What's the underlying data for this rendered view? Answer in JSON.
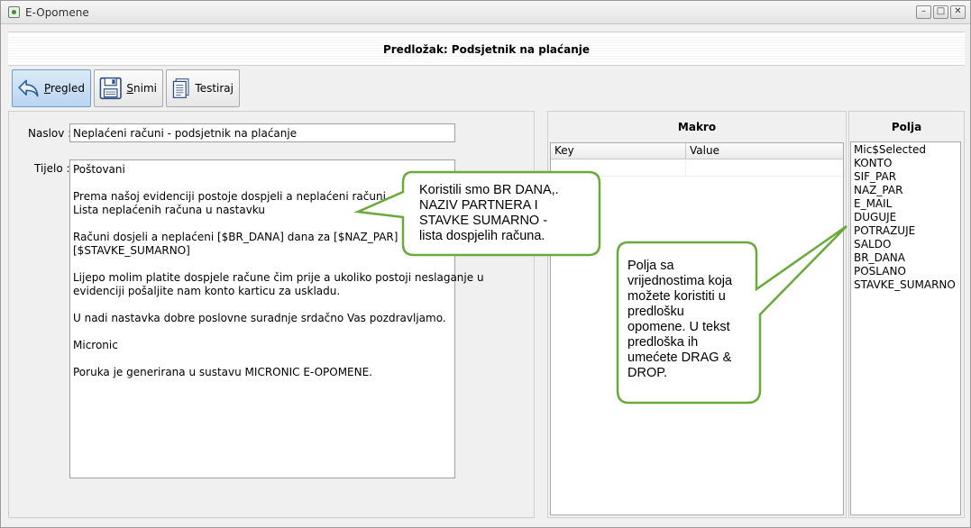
{
  "window": {
    "title": "E-Opomene",
    "controls": [
      "minimize",
      "maximize",
      "close"
    ]
  },
  "header": {
    "title": "Predložak: Podsjetnik na plaćanje"
  },
  "toolbar": {
    "pregled": {
      "label_hotkey": "P",
      "label_rest": "regled",
      "icon": "back-arrow-icon"
    },
    "snimi": {
      "label_hotkey": "S",
      "label_rest": "nimi",
      "icon": "floppy-disk-icon"
    },
    "testiraj": {
      "label": "Testiraj",
      "icon": "document-icon"
    }
  },
  "form": {
    "naslov_label": "Naslov :",
    "naslov_value": "Neplaćeni računi - podsjetnik na plaćanje",
    "tijelo_label": "Tijelo :",
    "tijelo_lines": [
      "Poštovani",
      "",
      "Prema našoj evidenciji postoje dospjeli a neplaćeni računi.",
      "Lista neplaćenih računa u nastavku",
      "",
      "Računi dosjeli a neplaćeni [$BR_DANA] dana za [$NAZ_PAR]",
      "[$STAVKE_SUMARNO]",
      "",
      "Lijepo molim platite dospjele račune čim prije a ukoliko postoji neslaganje u",
      "evidenciji pošaljite nam konto karticu za uskladu.",
      "",
      "U nadi nastavka dobre poslovne suradnje srdačno Vas pozdravljamo.",
      "",
      "Micronic",
      "",
      "Poruka je generirana u sustavu MICRONIC E-OPOMENE."
    ]
  },
  "makro": {
    "title": "Makro",
    "columns": [
      "Key",
      "Value"
    ],
    "rows": [
      [
        "",
        ""
      ]
    ]
  },
  "polja": {
    "title": "Polja",
    "items": [
      "Mic$Selected",
      "KONTO",
      "SIF_PAR",
      "NAZ_PAR",
      "E_MAIL",
      "DUGUJE",
      "POTRAZUJE",
      "SALDO",
      "BR_DANA",
      "POSLANO",
      "STAVKE_SUMARNO"
    ]
  },
  "callouts": {
    "accent_color": "#6aaa3a",
    "first": [
      "Koristili smo BR DANA,.",
      "NAZIV PARTNERA I",
      "STAVKE SUMARNO -",
      "lista dospjelih računa."
    ],
    "second": [
      "Polja sa",
      "vrijednostima koja",
      "možete koristiti u",
      "predlošku",
      "opomene. U tekst",
      "predloška ih",
      "umećete DRAG &",
      "DROP."
    ]
  }
}
